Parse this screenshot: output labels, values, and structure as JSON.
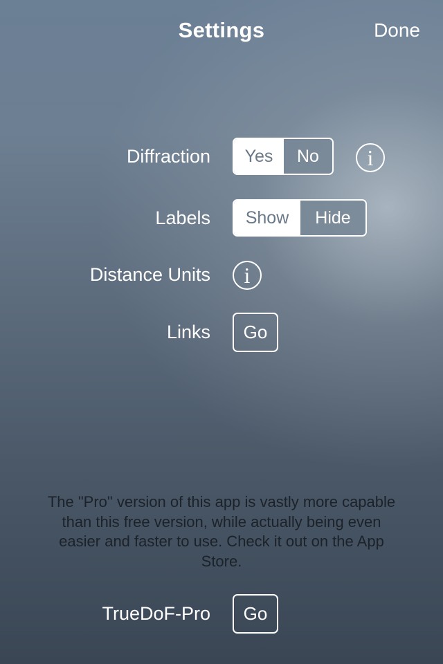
{
  "header": {
    "title": "Settings",
    "done_label": "Done"
  },
  "settings": {
    "diffraction": {
      "label": "Diffraction",
      "options": [
        "Yes",
        "No"
      ],
      "selected": "Yes",
      "info_icon": "info-icon"
    },
    "labels": {
      "label": "Labels",
      "options": [
        "Show",
        "Hide"
      ],
      "selected": "Show"
    },
    "distance_units": {
      "label": "Distance Units",
      "info_icon": "info-icon"
    },
    "links": {
      "label": "Links",
      "button_label": "Go"
    }
  },
  "promo": {
    "text": "The \"Pro\" version of this app is vastly more capable than this free version, while actually being even easier and faster to use. Check it out on the App Store.",
    "item_label": "TrueDoF-Pro",
    "button_label": "Go"
  },
  "info_glyph": "i"
}
